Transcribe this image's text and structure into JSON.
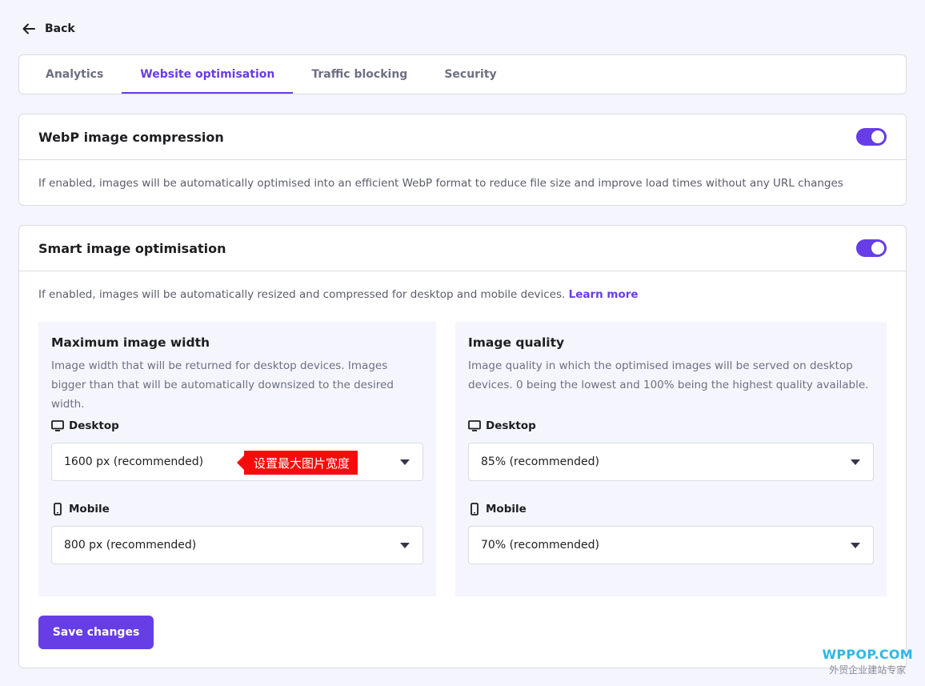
{
  "back_label": "Back",
  "tabs": [
    {
      "label": "Analytics",
      "active": false
    },
    {
      "label": "Website optimisation",
      "active": true
    },
    {
      "label": "Traffic blocking",
      "active": false
    },
    {
      "label": "Security",
      "active": false
    }
  ],
  "webp": {
    "title": "WebP image compression",
    "enabled": true,
    "description": "If enabled, images will be automatically optimised into an efficient WebP format to reduce file size and improve load times without any URL changes"
  },
  "smart": {
    "title": "Smart image optimisation",
    "enabled": true,
    "description": "If enabled, images will be automatically resized and compressed for desktop and mobile devices.",
    "learn_more": "Learn more",
    "width_panel": {
      "title": "Maximum image width",
      "description": "Image width that will be returned for desktop devices. Images bigger than that will be automatically downsized to the desired width.",
      "desktop_label": "Desktop",
      "desktop_value": "1600 px (recommended)",
      "mobile_label": "Mobile",
      "mobile_value": "800 px (recommended)",
      "annotation": "设置最大图片宽度"
    },
    "quality_panel": {
      "title": "Image quality",
      "description": "Image quality in which the optimised images will be served on desktop devices. 0 being the lowest and 100% being the highest quality available.",
      "desktop_label": "Desktop",
      "desktop_value": "85% (recommended)",
      "mobile_label": "Mobile",
      "mobile_value": "70% (recommended)"
    },
    "save_label": "Save changes"
  },
  "watermark": {
    "brand": "WPPOP.COM",
    "sub": "外贸企业建站专家"
  },
  "colors": {
    "accent": "#673de6",
    "annotation": "#fa0b0b"
  }
}
